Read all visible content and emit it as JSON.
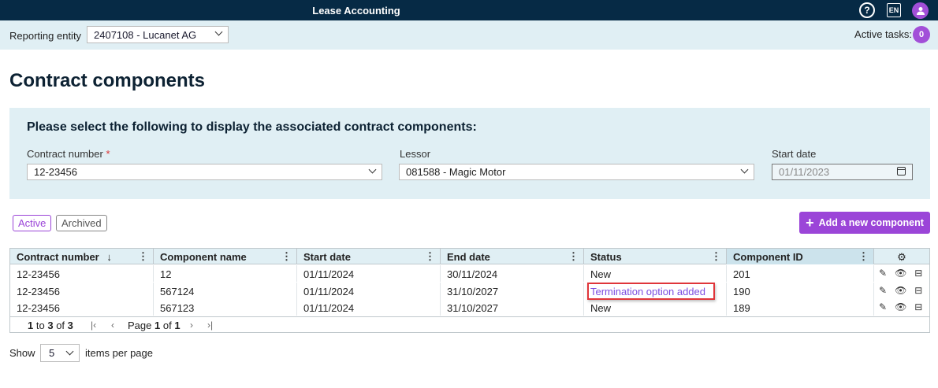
{
  "app": {
    "title": "Lease Accounting",
    "lang": "EN",
    "help_glyph": "?"
  },
  "entitybar": {
    "label": "Reporting entity",
    "entity": "2407108 - Lucanet AG",
    "tasks_label": "Active tasks:",
    "tasks_count": "0"
  },
  "page": {
    "title": "Contract components"
  },
  "filters": {
    "heading": "Please select the following to display the associated contract components:",
    "contract_label": "Contract number",
    "required_mark": "*",
    "contract_value": "12-23456",
    "lessor_label": "Lessor",
    "lessor_value": "081588 - Magic Motor",
    "start_label": "Start date",
    "start_value": "01/11/2023"
  },
  "tabs": {
    "active": "Active",
    "archived": "Archived"
  },
  "add_button": {
    "label": "Add a new component",
    "plus": "+"
  },
  "table": {
    "headers": [
      "Contract number",
      "Component name",
      "Start date",
      "End date",
      "Status",
      "Component ID"
    ],
    "sort_glyph": "↓",
    "menu_glyph": "⋮",
    "settings_glyph": "⚙",
    "rows": [
      [
        "12-23456",
        "12",
        "01/11/2024",
        "30/11/2024",
        "New",
        "201"
      ],
      [
        "12-23456",
        "567124",
        "01/11/2024",
        "31/10/2027",
        "Termination option added",
        "190"
      ],
      [
        "12-23456",
        "567123",
        "01/11/2024",
        "31/10/2027",
        "New",
        "189"
      ]
    ],
    "action_glyphs": {
      "edit": "✎",
      "view": "👁",
      "archive": "⊟"
    }
  },
  "pagination": {
    "range_from": "1",
    "to_text": "to",
    "range_to": "3",
    "of_text": "of",
    "total": "3",
    "page_text": "Page",
    "page": "1",
    "page_of": "of",
    "pages": "1",
    "first": "|‹",
    "prev": "‹",
    "next": "›",
    "last": "›|"
  },
  "footer": {
    "show_label": "Show",
    "per_page": "5",
    "items_label": "items per page"
  }
}
